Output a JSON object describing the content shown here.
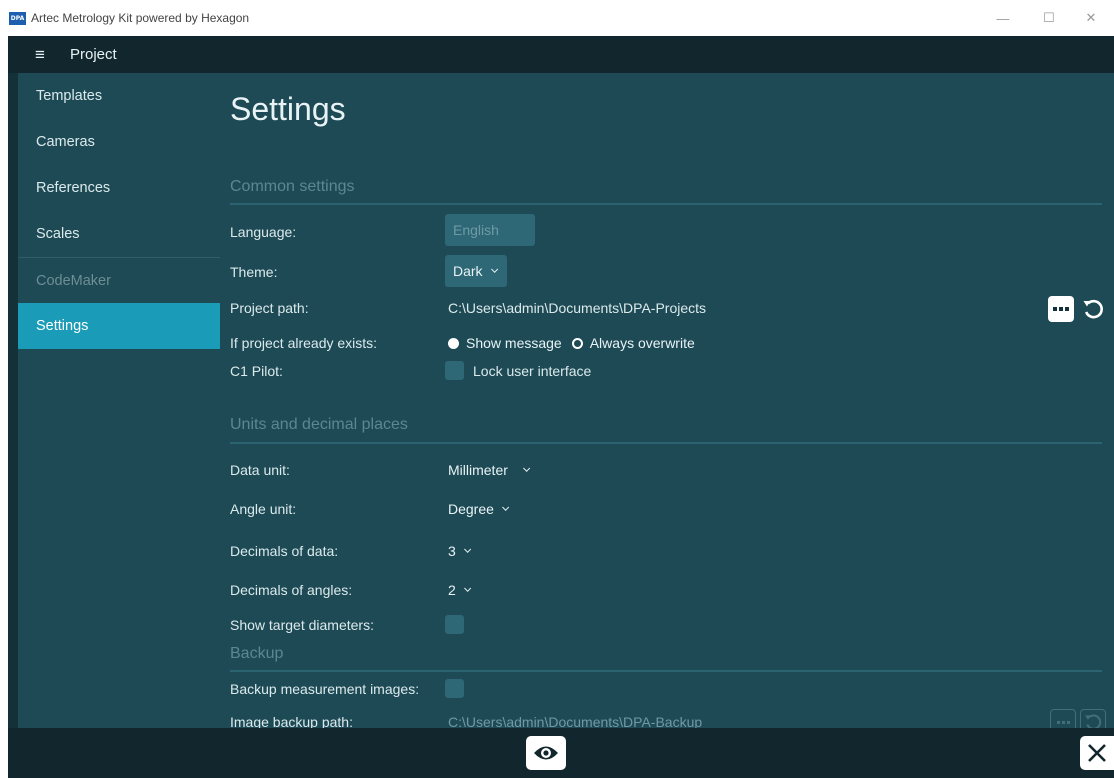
{
  "window": {
    "logo_text": "DPA",
    "title": "Artec Metrology Kit powered by Hexagon",
    "minimize_glyph": "—",
    "maximize_glyph": "☐",
    "close_glyph": "✕"
  },
  "topbar": {
    "menu_icon": "≡",
    "title": "Project"
  },
  "sidebar": {
    "items": [
      {
        "label": "Templates"
      },
      {
        "label": "Cameras"
      },
      {
        "label": "References"
      },
      {
        "label": "Scales"
      },
      {
        "label": "CodeMaker"
      },
      {
        "label": "Settings"
      }
    ],
    "active_item": "Settings",
    "disabled_item": "CodeMaker"
  },
  "page": {
    "title": "Settings"
  },
  "common": {
    "section_title": "Common settings",
    "language_label": "Language:",
    "language_value": "English",
    "theme_label": "Theme:",
    "theme_value": "Dark",
    "project_path_label": "Project path:",
    "project_path_value": "C:\\Users\\admin\\Documents\\DPA-Projects",
    "exists_label": "If project already exists:",
    "exists_options": [
      "Show message",
      "Always overwrite"
    ],
    "exists_selected": "Show message",
    "c1_label": "C1 Pilot:",
    "lock_ui_label": "Lock user interface",
    "lock_ui_checked": false
  },
  "units": {
    "section_title": "Units and decimal places",
    "data_unit_label": "Data unit:",
    "data_unit_value": "Millimeter",
    "angle_unit_label": "Angle unit:",
    "angle_unit_value": "Degree",
    "decimals_data_label": "Decimals of data:",
    "decimals_data_value": "3",
    "decimals_angles_label": "Decimals of angles:",
    "decimals_angles_value": "2",
    "show_diam_label": "Show target diameters:",
    "show_diam_checked": false
  },
  "backup": {
    "section_title": "Backup",
    "backup_images_label": "Backup measurement images:",
    "backup_images_checked": false,
    "image_path_label": "Image backup path:",
    "image_path_value": "C:\\Users\\admin\\Documents\\DPA-Backup"
  },
  "colors": {
    "accent": "#1a9cb8",
    "panel": "#1e4a55",
    "frame": "#143039",
    "bar": "#12262e"
  }
}
